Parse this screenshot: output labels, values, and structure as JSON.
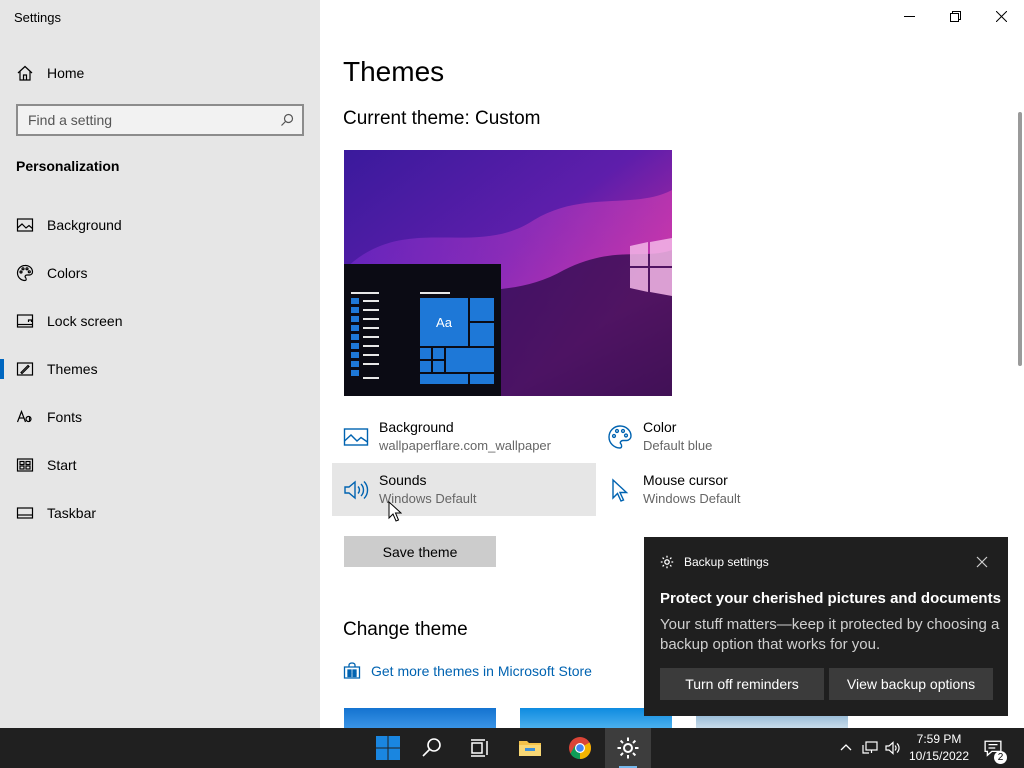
{
  "window": {
    "title": "Settings"
  },
  "sidebar": {
    "home_label": "Home",
    "search_placeholder": "Find a setting",
    "section_title": "Personalization",
    "items": [
      {
        "label": "Background",
        "icon": "picture-icon"
      },
      {
        "label": "Colors",
        "icon": "palette-icon"
      },
      {
        "label": "Lock screen",
        "icon": "lock-screen-icon"
      },
      {
        "label": "Themes",
        "icon": "themes-icon",
        "active": true
      },
      {
        "label": "Fonts",
        "icon": "fonts-icon"
      },
      {
        "label": "Start",
        "icon": "start-icon"
      },
      {
        "label": "Taskbar",
        "icon": "taskbar-icon"
      }
    ]
  },
  "main": {
    "page_title": "Themes",
    "current_theme_label": "Current theme: Custom",
    "preview_sample_text": "Aa",
    "properties": {
      "background": {
        "name": "Background",
        "value": "wallpaperflare.com_wallpaper"
      },
      "color": {
        "name": "Color",
        "value": "Default blue"
      },
      "sounds": {
        "name": "Sounds",
        "value": "Windows Default"
      },
      "mouse_cursor": {
        "name": "Mouse cursor",
        "value": "Windows Default"
      }
    },
    "save_theme_label": "Save theme",
    "change_theme_title": "Change theme",
    "store_link_label": "Get more themes in Microsoft Store"
  },
  "toast": {
    "app_name": "Backup settings",
    "title": "Protect your cherished pictures and documents",
    "body": "Your stuff matters—keep it protected by choosing a backup option that works for you.",
    "button_1": "Turn off reminders",
    "button_2": "View backup options"
  },
  "taskbar": {
    "time": "7:59 PM",
    "date": "10/15/2022",
    "notification_count": "2"
  },
  "colors": {
    "accent": "#0067c0",
    "link": "#0063b1",
    "sidebar_bg": "#e6e6e6",
    "taskbar_bg": "#202020",
    "toast_bg": "#1f1f1f"
  }
}
